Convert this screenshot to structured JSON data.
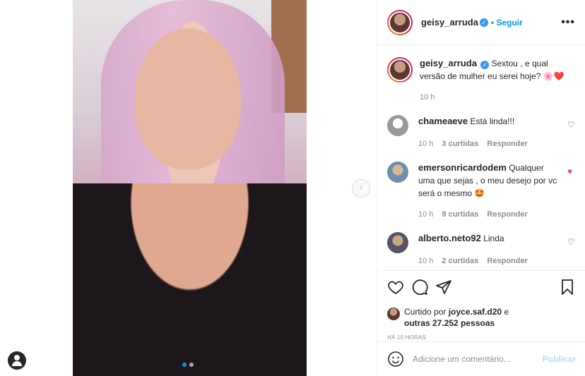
{
  "post": {
    "author": "geisy_arruda",
    "follow_label": "• Seguir",
    "verified_mark": "✓",
    "more_label": "•••",
    "image_pages": 2,
    "active_page": 1
  },
  "caption": {
    "author": "geisy_arruda",
    "text": "Sextou , e qual versão de mulher eu serei hoje? 🌸❤️",
    "time": "10 h"
  },
  "comments": [
    {
      "author": "chameaeve",
      "text": "Está linda!!!",
      "time": "10 h",
      "likes": "3 curtidas",
      "reply": "Responder",
      "liked": false
    },
    {
      "author": "emersonricardodem",
      "text": "Qualquer uma que sejas , o meu desejo por vc será o mesmo 🤩",
      "time": "10 h",
      "likes": "9 curtidas",
      "reply": "Responder",
      "liked": true
    },
    {
      "author": "alberto.neto92",
      "text": "Linda",
      "time": "10 h",
      "likes": "2 curtidas",
      "reply": "Responder",
      "liked": false
    }
  ],
  "likes": {
    "prefix": "Curtido por",
    "user": "joyce.saf.d20",
    "conjunction": "e",
    "others": "outras 27.252 pessoas"
  },
  "timestamp": "HÁ 10 HORAS",
  "add_comment": {
    "placeholder": "Adicione um comentário...",
    "publish": "Publicar"
  },
  "colors": {
    "accent": "#0095f6",
    "liked": "#ed4956",
    "muted": "#8e8e8e",
    "publish_disabled": "#b2dffc"
  }
}
